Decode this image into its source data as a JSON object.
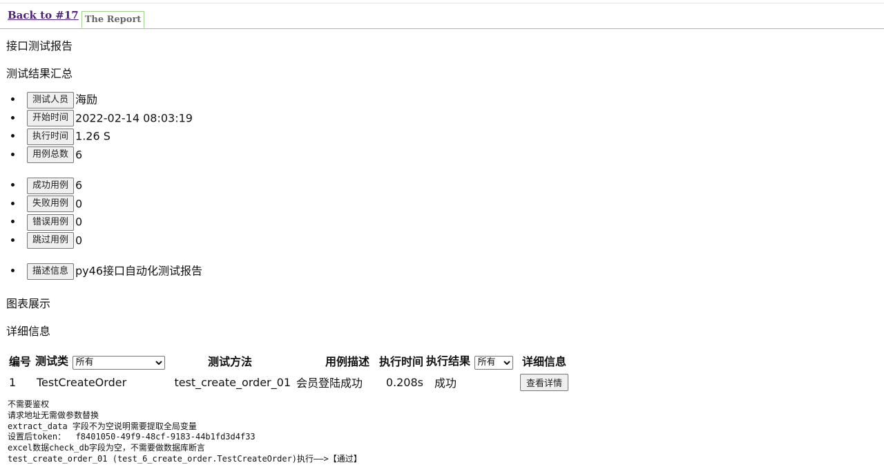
{
  "nav": {
    "back_link": "Back to #17",
    "tab_label": "The Report"
  },
  "report": {
    "title": "接口测试报告",
    "summary_heading": "测试结果汇总",
    "group1": [
      {
        "label": "测试人员",
        "value": "海励"
      },
      {
        "label": "开始时间",
        "value": "2022-02-14 08:03:19"
      },
      {
        "label": "执行时间",
        "value": "1.26 S"
      },
      {
        "label": "用例总数",
        "value": "6"
      }
    ],
    "group2": [
      {
        "label": "成功用例",
        "value": "6"
      },
      {
        "label": "失败用例",
        "value": "0"
      },
      {
        "label": "错误用例",
        "value": "0"
      },
      {
        "label": "跳过用例",
        "value": "0"
      }
    ],
    "group3": [
      {
        "label": "描述信息",
        "value": "py46接口自动化测试报告"
      }
    ],
    "chart_heading": "图表展示",
    "detail_heading": "详细信息"
  },
  "table": {
    "headers": {
      "no": "编号",
      "class": "测试类",
      "method": "测试方法",
      "desc": "用例描述",
      "time": "执行时间",
      "result": "执行结果",
      "detail": "详细信息"
    },
    "class_filter": "所有",
    "result_filter": "所有",
    "rows": [
      {
        "no": "1",
        "class": "TestCreateOrder",
        "method": "test_create_order_01",
        "desc": "会员登陆成功",
        "time": "0.208s",
        "result": "成功",
        "detail_button": "查看详情"
      }
    ]
  },
  "log_lines": [
    "不需要鉴权",
    "请求地址无需做参数替换",
    "extract_data 字段不为空说明需要提取全局变量",
    "设置后token：  f8401050-49f9-48cf-9183-44b1fd3d4f33",
    "excel数据check_db字段为空，不需要做数据库断言",
    "test_create_order_01 (test_6_create_order.TestCreateOrder)执行——>【通过】"
  ]
}
